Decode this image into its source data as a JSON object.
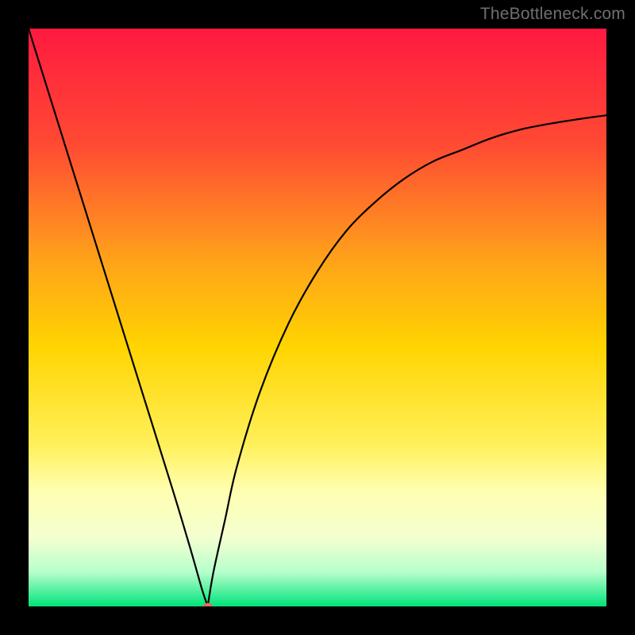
{
  "watermark": "TheBottleneck.com",
  "chart_data": {
    "type": "line",
    "title": "",
    "xlabel": "",
    "ylabel": "",
    "xlim": [
      0,
      100
    ],
    "ylim": [
      0,
      100
    ],
    "grid": false,
    "background_gradient_stops": [
      {
        "offset": 0.0,
        "color": "#ff1a40"
      },
      {
        "offset": 0.2,
        "color": "#ff4a33"
      },
      {
        "offset": 0.4,
        "color": "#ffa21a"
      },
      {
        "offset": 0.55,
        "color": "#ffd400"
      },
      {
        "offset": 0.72,
        "color": "#fff05a"
      },
      {
        "offset": 0.8,
        "color": "#ffffb0"
      },
      {
        "offset": 0.88,
        "color": "#f4ffd0"
      },
      {
        "offset": 0.94,
        "color": "#b8ffcc"
      },
      {
        "offset": 1.0,
        "color": "#00e47a"
      }
    ],
    "optimal_x": 31,
    "marker": {
      "x": 31,
      "y": 0,
      "radius": 5,
      "color": "#e56a5a"
    },
    "series": [
      {
        "name": "bottleneck_curve_left",
        "x": [
          0,
          5,
          10,
          15,
          20,
          25,
          28,
          30,
          31
        ],
        "y": [
          100,
          84,
          68,
          52,
          36,
          20,
          10,
          3,
          0
        ]
      },
      {
        "name": "bottleneck_curve_right",
        "x": [
          31,
          32,
          34,
          36,
          40,
          45,
          50,
          55,
          60,
          65,
          70,
          75,
          80,
          85,
          90,
          95,
          100
        ],
        "y": [
          0,
          6,
          15,
          24,
          37,
          49,
          58,
          65,
          70,
          74,
          77,
          79,
          81,
          82.5,
          83.5,
          84.3,
          85
        ]
      }
    ]
  }
}
